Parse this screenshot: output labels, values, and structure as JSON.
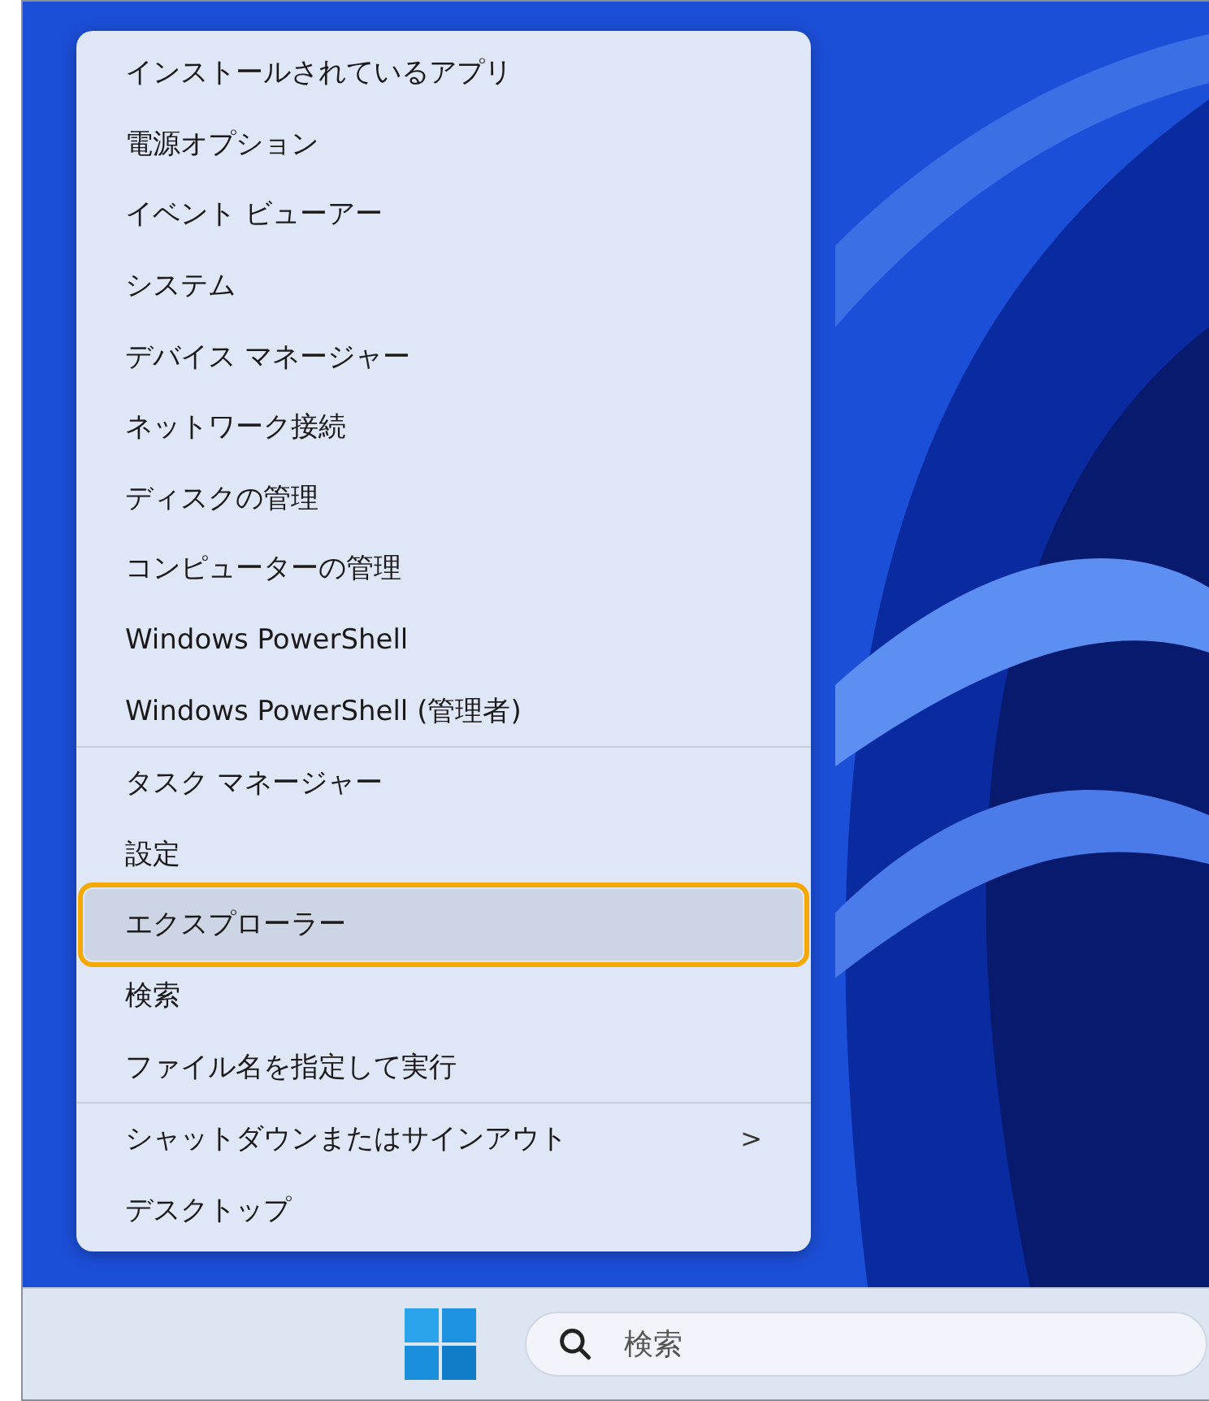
{
  "context_menu": {
    "groups": [
      {
        "items": [
          {
            "label": "インストールされているアプリ",
            "selected": false
          },
          {
            "label": "電源オプション",
            "selected": false
          },
          {
            "label": "イベント ビューアー",
            "selected": false
          },
          {
            "label": "システム",
            "selected": false
          },
          {
            "label": "デバイス マネージャー",
            "selected": false
          },
          {
            "label": "ネットワーク接続",
            "selected": false
          },
          {
            "label": "ディスクの管理",
            "selected": false
          },
          {
            "label": "コンピューターの管理",
            "selected": false
          },
          {
            "label": "Windows PowerShell",
            "selected": false
          },
          {
            "label": "Windows PowerShell (管理者)",
            "selected": false
          }
        ]
      },
      {
        "items": [
          {
            "label": "タスク マネージャー",
            "selected": false
          },
          {
            "label": "設定",
            "selected": false
          },
          {
            "label": "エクスプローラー",
            "selected": true
          },
          {
            "label": "検索",
            "selected": false
          },
          {
            "label": "ファイル名を指定して実行",
            "selected": false
          }
        ]
      },
      {
        "items": [
          {
            "label": "シャットダウンまたはサインアウト",
            "selected": false,
            "submenu_arrow": ">"
          },
          {
            "label": "デスクトップ",
            "selected": false
          }
        ]
      }
    ]
  },
  "taskbar": {
    "search": {
      "placeholder": "検索"
    }
  }
}
